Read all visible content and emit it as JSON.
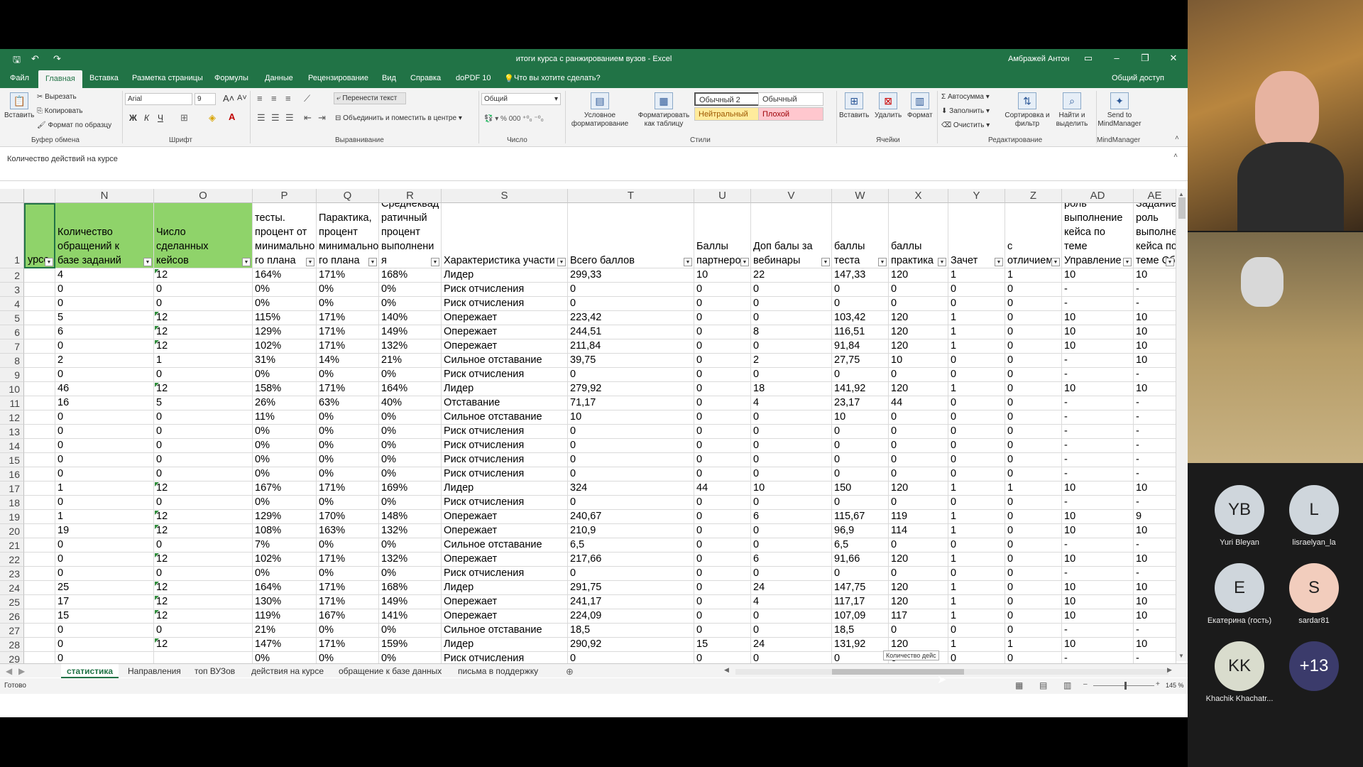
{
  "window": {
    "title": "итоги курса с ранжированием вузов - Excel",
    "user": "Амбражей Антон"
  },
  "ribbon_tabs": [
    "Файл",
    "Главная",
    "Вставка",
    "Разметка страницы",
    "Формулы",
    "Данные",
    "Рецензирование",
    "Вид",
    "Справка",
    "doPDF 10",
    "Что вы хотите сделать?",
    "Общий доступ"
  ],
  "ribbon": {
    "clipboard": {
      "paste": "Вставить",
      "cut": "Вырезать",
      "copy": "Копировать",
      "format_painter": "Формат по образцу",
      "group": "Буфер обмена"
    },
    "font": {
      "name": "Arial",
      "size": "9",
      "group": "Шрифт",
      "bold": "Ж",
      "italic": "К",
      "underline": "Ч"
    },
    "alignment": {
      "wrap": "Перенести текст",
      "merge": "Объединить и поместить в центре",
      "group": "Выравнивание"
    },
    "number": {
      "format": "Общий",
      "group": "Число"
    },
    "styles": {
      "conditional": "Условное форматирование",
      "table": "Форматировать как таблицу",
      "normal2": "Обычный 2",
      "normal": "Обычный",
      "neutral": "Нейтральный",
      "bad": "Плохой",
      "group": "Стили"
    },
    "cells": {
      "insert": "Вставить",
      "delete": "Удалить",
      "format": "Формат",
      "group": "Ячейки"
    },
    "editing": {
      "autosum": "Автосумма",
      "fill": "Заполнить",
      "clear": "Очистить",
      "sort": "Сортировка и фильтр",
      "find": "Найти и выделить",
      "group": "Редактирование"
    },
    "mindmanager": {
      "send": "Send to MindManager",
      "group": "MindManager"
    }
  },
  "formula_bar": {
    "content": "Количество действий на курсе"
  },
  "columns": [
    "",
    "N",
    "O",
    "P",
    "Q",
    "R",
    "S",
    "T",
    "U",
    "V",
    "W",
    "X",
    "Y",
    "Z",
    "AD",
    "AE"
  ],
  "headers": [
    "урсе",
    "Количество обращений к базе заданий",
    "Число сделанных кейсов",
    "тесты. процент от минимально го плана",
    "Парактика, процент минимально го плана",
    "Среднеквад ратичный процент выполнени я",
    "Характеристика участи",
    "Всего баллов",
    "Баллы партнеро",
    "Доп балы за вебинары",
    "баллы теста",
    "баллы практика",
    "Зачет",
    "с отличием",
    "Задание.Конт роль выполнение кейса по теме Управление",
    "Задание. роль выполне кейса по теме Сб"
  ],
  "rows": [
    {
      "n": "2",
      "c": [
        "",
        "4",
        "12",
        "164%",
        "171%",
        "168%",
        "Лидер",
        "299,33",
        "10",
        "22",
        "147,33",
        "120",
        "1",
        "1",
        "10",
        "10"
      ]
    },
    {
      "n": "3",
      "c": [
        "",
        "0",
        "0",
        "0%",
        "0%",
        "0%",
        "Риск отчисления",
        "0",
        "0",
        "0",
        "0",
        "0",
        "0",
        "0",
        "-",
        "-"
      ]
    },
    {
      "n": "4",
      "c": [
        "",
        "0",
        "0",
        "0%",
        "0%",
        "0%",
        "Риск отчисления",
        "0",
        "0",
        "0",
        "0",
        "0",
        "0",
        "0",
        "-",
        "-"
      ]
    },
    {
      "n": "5",
      "c": [
        "",
        "5",
        "12",
        "115%",
        "171%",
        "140%",
        "Опережает",
        "223,42",
        "0",
        "0",
        "103,42",
        "120",
        "1",
        "0",
        "10",
        "10"
      ]
    },
    {
      "n": "6",
      "c": [
        "",
        "6",
        "12",
        "129%",
        "171%",
        "149%",
        "Опережает",
        "244,51",
        "0",
        "8",
        "116,51",
        "120",
        "1",
        "0",
        "10",
        "10"
      ]
    },
    {
      "n": "7",
      "c": [
        "",
        "0",
        "12",
        "102%",
        "171%",
        "132%",
        "Опережает",
        "211,84",
        "0",
        "0",
        "91,84",
        "120",
        "1",
        "0",
        "10",
        "10"
      ]
    },
    {
      "n": "8",
      "c": [
        "",
        "2",
        "1",
        "31%",
        "14%",
        "21%",
        "Сильное отставание",
        "39,75",
        "0",
        "2",
        "27,75",
        "10",
        "0",
        "0",
        "-",
        "10"
      ]
    },
    {
      "n": "9",
      "c": [
        "",
        "0",
        "0",
        "0%",
        "0%",
        "0%",
        "Риск отчисления",
        "0",
        "0",
        "0",
        "0",
        "0",
        "0",
        "0",
        "-",
        "-"
      ]
    },
    {
      "n": "10",
      "c": [
        "",
        "46",
        "12",
        "158%",
        "171%",
        "164%",
        "Лидер",
        "279,92",
        "0",
        "18",
        "141,92",
        "120",
        "1",
        "0",
        "10",
        "10"
      ]
    },
    {
      "n": "11",
      "c": [
        "",
        "16",
        "5",
        "26%",
        "63%",
        "40%",
        "Отставание",
        "71,17",
        "0",
        "4",
        "23,17",
        "44",
        "0",
        "0",
        "-",
        "-"
      ]
    },
    {
      "n": "12",
      "c": [
        "",
        "0",
        "0",
        "11%",
        "0%",
        "0%",
        "Сильное отставание",
        "10",
        "0",
        "0",
        "10",
        "0",
        "0",
        "0",
        "-",
        "-"
      ]
    },
    {
      "n": "13",
      "c": [
        "",
        "0",
        "0",
        "0%",
        "0%",
        "0%",
        "Риск отчисления",
        "0",
        "0",
        "0",
        "0",
        "0",
        "0",
        "0",
        "-",
        "-"
      ]
    },
    {
      "n": "14",
      "c": [
        "",
        "0",
        "0",
        "0%",
        "0%",
        "0%",
        "Риск отчисления",
        "0",
        "0",
        "0",
        "0",
        "0",
        "0",
        "0",
        "-",
        "-"
      ]
    },
    {
      "n": "15",
      "c": [
        "",
        "0",
        "0",
        "0%",
        "0%",
        "0%",
        "Риск отчисления",
        "0",
        "0",
        "0",
        "0",
        "0",
        "0",
        "0",
        "-",
        "-"
      ]
    },
    {
      "n": "16",
      "c": [
        "",
        "0",
        "0",
        "0%",
        "0%",
        "0%",
        "Риск отчисления",
        "0",
        "0",
        "0",
        "0",
        "0",
        "0",
        "0",
        "-",
        "-"
      ]
    },
    {
      "n": "17",
      "c": [
        "",
        "1",
        "12",
        "167%",
        "171%",
        "169%",
        "Лидер",
        "324",
        "44",
        "10",
        "150",
        "120",
        "1",
        "1",
        "10",
        "10"
      ]
    },
    {
      "n": "18",
      "c": [
        "",
        "0",
        "0",
        "0%",
        "0%",
        "0%",
        "Риск отчисления",
        "0",
        "0",
        "0",
        "0",
        "0",
        "0",
        "0",
        "-",
        "-"
      ]
    },
    {
      "n": "19",
      "c": [
        "",
        "1",
        "12",
        "129%",
        "170%",
        "148%",
        "Опережает",
        "240,67",
        "0",
        "6",
        "115,67",
        "119",
        "1",
        "0",
        "10",
        "9"
      ]
    },
    {
      "n": "20",
      "c": [
        "",
        "19",
        "12",
        "108%",
        "163%",
        "132%",
        "Опережает",
        "210,9",
        "0",
        "0",
        "96,9",
        "114",
        "1",
        "0",
        "10",
        "10"
      ]
    },
    {
      "n": "21",
      "c": [
        "",
        "0",
        "0",
        "7%",
        "0%",
        "0%",
        "Сильное отставание",
        "6,5",
        "0",
        "0",
        "6,5",
        "0",
        "0",
        "0",
        "-",
        "-"
      ]
    },
    {
      "n": "22",
      "c": [
        "",
        "0",
        "12",
        "102%",
        "171%",
        "132%",
        "Опережает",
        "217,66",
        "0",
        "6",
        "91,66",
        "120",
        "1",
        "0",
        "10",
        "10"
      ]
    },
    {
      "n": "23",
      "c": [
        "",
        "0",
        "0",
        "0%",
        "0%",
        "0%",
        "Риск отчисления",
        "0",
        "0",
        "0",
        "0",
        "0",
        "0",
        "0",
        "-",
        "-"
      ]
    },
    {
      "n": "24",
      "c": [
        "",
        "25",
        "12",
        "164%",
        "171%",
        "168%",
        "Лидер",
        "291,75",
        "0",
        "24",
        "147,75",
        "120",
        "1",
        "0",
        "10",
        "10"
      ]
    },
    {
      "n": "25",
      "c": [
        "",
        "17",
        "12",
        "130%",
        "171%",
        "149%",
        "Опережает",
        "241,17",
        "0",
        "4",
        "117,17",
        "120",
        "1",
        "0",
        "10",
        "10"
      ]
    },
    {
      "n": "26",
      "c": [
        "",
        "15",
        "12",
        "119%",
        "167%",
        "141%",
        "Опережает",
        "224,09",
        "0",
        "0",
        "107,09",
        "117",
        "1",
        "0",
        "10",
        "10"
      ]
    },
    {
      "n": "27",
      "c": [
        "",
        "0",
        "0",
        "21%",
        "0%",
        "0%",
        "Сильное отставание",
        "18,5",
        "0",
        "0",
        "18,5",
        "0",
        "0",
        "0",
        "-",
        "-"
      ]
    },
    {
      "n": "28",
      "c": [
        "",
        "0",
        "12",
        "147%",
        "171%",
        "159%",
        "Лидер",
        "290,92",
        "15",
        "24",
        "131,92",
        "120",
        "1",
        "1",
        "10",
        "10"
      ]
    },
    {
      "n": "29",
      "c": [
        "",
        "0",
        "",
        "0%",
        "0%",
        "0%",
        "Риск отчисления",
        "0",
        "0",
        "0",
        "0",
        "0",
        "0",
        "0",
        "-",
        "-"
      ]
    }
  ],
  "tooltip": "Количество дейс",
  "sheet_tabs": [
    "статистика",
    "Направления",
    "топ ВУЗов",
    "действия на курсе",
    "обращение к базе данных",
    "письма в поддержку"
  ],
  "status": {
    "ready": "Готово",
    "zoom": "145 %"
  },
  "participants": [
    {
      "initials": "YB",
      "name": "Yuri Bleyan",
      "color": "#cfd6dc"
    },
    {
      "initials": "L",
      "name": "lisraelyan_la",
      "color": "#cfd6dc"
    },
    {
      "initials": "E",
      "name": "Екатерина (гость)",
      "color": "#cfd6dc"
    },
    {
      "initials": "S",
      "name": "sardar81",
      "color": "#f2cdbd"
    },
    {
      "initials": "KK",
      "name": "Khachik Khachatr...",
      "color": "#d9dccd"
    },
    {
      "initials": "+13",
      "name": "",
      "color": "#3b3b6b"
    }
  ]
}
